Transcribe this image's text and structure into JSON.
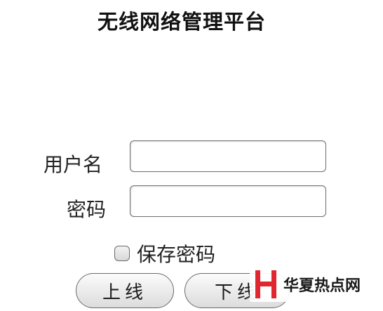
{
  "app": {
    "title": "无线网络管理平台"
  },
  "form": {
    "username_label": "用户名",
    "username_value": "",
    "password_label": "密码",
    "password_value": "",
    "remember_label": "保存密码",
    "remember_checked": false
  },
  "buttons": {
    "online_label": "上线",
    "offline_label": "下线"
  },
  "watermark": {
    "text": "华夏热点网",
    "logo_color": "#e0262f"
  }
}
